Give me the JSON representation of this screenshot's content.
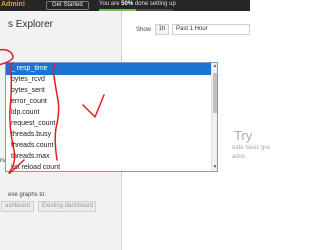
{
  "topbar": {
    "admin_text": "Admin!",
    "get_started_label": "Get Started",
    "done_prefix": "You are ",
    "done_percent": "50%",
    "done_suffix": " done setting up",
    "progress": 0.5
  },
  "left": {
    "title": "s Explorer",
    "section_label": "rs",
    "share_text": "ese graphs to:",
    "dashboard_button": "ashboard",
    "existing_dashboard_button": "Existing dashboard"
  },
  "right": {
    "show_label": "Show",
    "unit": "1h",
    "range": "Past 1 Hour",
    "placeholder_title": "Try",
    "placeholder_line1": "eate basic gra",
    "placeholder_line2": "adve"
  },
  "metrics": {
    "items": [
      {
        "label": "_ resp_time",
        "selected": true
      },
      {
        "label": "bytes_rcvd",
        "selected": false
      },
      {
        "label": "bytes_sent",
        "selected": false
      },
      {
        "label": "error_count",
        "selected": false
      },
      {
        "label": "ldp.count",
        "selected": false
      },
      {
        "label": "request_count",
        "selected": false
      },
      {
        "label": "threads.busy",
        "selected": false
      },
      {
        "label": "threads.count",
        "selected": false
      },
      {
        "label": "threads.max",
        "selected": false
      },
      {
        "label": "ilst reload count",
        "selected": false
      }
    ]
  },
  "colors": {
    "selected": "#1e73d0",
    "annotation": "#e02020",
    "progress": "#6cc24a",
    "admin": "#f0a030"
  }
}
